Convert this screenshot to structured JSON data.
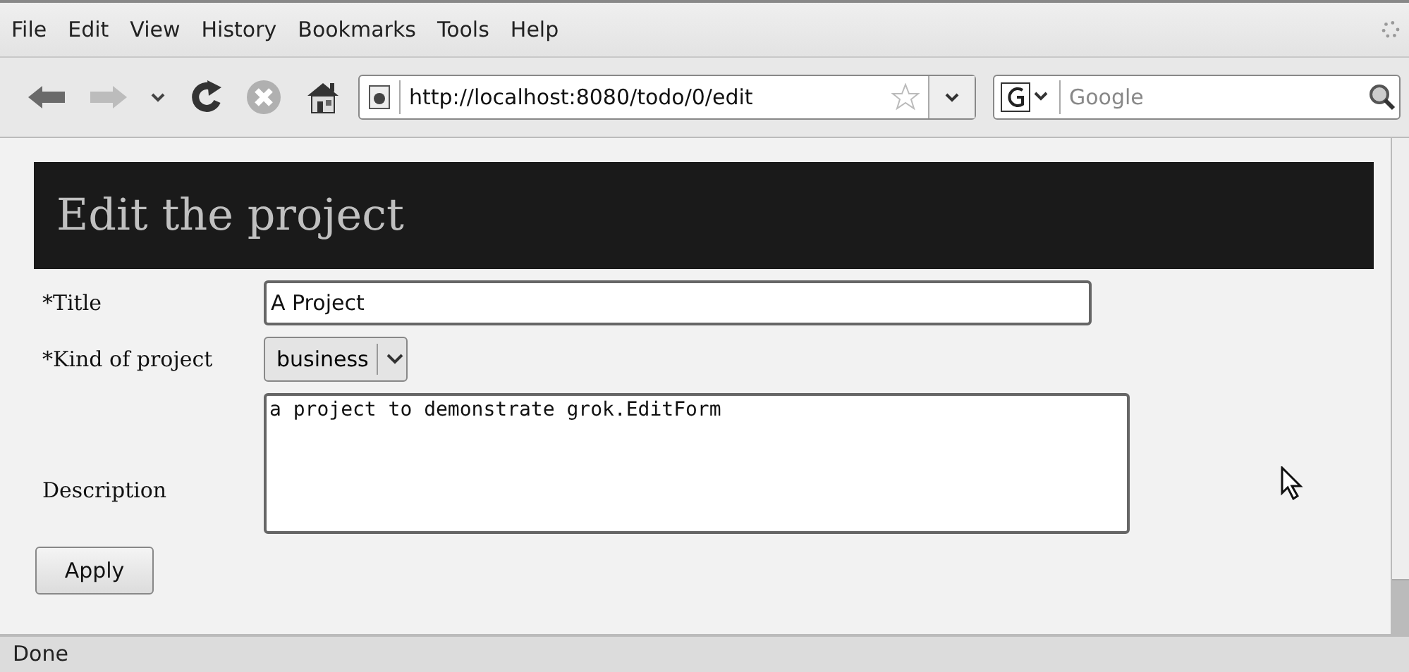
{
  "menu": [
    "File",
    "Edit",
    "View",
    "History",
    "Bookmarks",
    "Tools",
    "Help"
  ],
  "toolbar": {
    "back_disabled": false,
    "forward_disabled": true,
    "url": "http://localhost:8080/todo/0/edit",
    "bookmarked": false,
    "search": {
      "placeholder": "Google"
    }
  },
  "page": {
    "heading": "Edit the project",
    "fields": [
      {
        "kind": "text",
        "label": "*Title",
        "value": "A Project"
      },
      {
        "kind": "select",
        "label": "*Kind of project",
        "value": "business"
      },
      {
        "kind": "textarea",
        "label": "Description",
        "value": "a project to demonstrate grok.EditForm"
      }
    ],
    "buttons": [
      "Apply"
    ]
  },
  "status_bar": {
    "text": "Done"
  }
}
